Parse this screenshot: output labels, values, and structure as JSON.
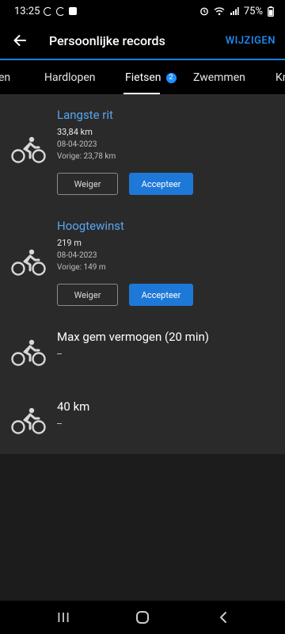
{
  "status": {
    "time": "13:25",
    "battery": "75%"
  },
  "appbar": {
    "title": "Persoonlijke records",
    "edit_label": "WIJZIGEN"
  },
  "tabs": [
    {
      "label": "en"
    },
    {
      "label": "Hardlopen"
    },
    {
      "label": "Fietsen",
      "badge": "2"
    },
    {
      "label": "Zwemmen"
    },
    {
      "label": "Kr"
    }
  ],
  "records": [
    {
      "title": "Langste rit",
      "value": "33,84 km",
      "date": "08-04-2023",
      "previous": "Vorige: 23,78 km",
      "reject_label": "Weiger",
      "accept_label": "Accepteer"
    },
    {
      "title": "Hoogtewinst",
      "value": "219 m",
      "date": "08-04-2023",
      "previous": "Vorige: 149 m",
      "reject_label": "Weiger",
      "accept_label": "Accepteer"
    },
    {
      "title": "Max gem vermogen (20 min)",
      "value": "--"
    },
    {
      "title": "40 km",
      "value": "--"
    }
  ],
  "colors": {
    "accent": "#1e90ff",
    "button": "#1e78d8",
    "link": "#58a6ef"
  },
  "icons": [
    "back-arrow-icon",
    "bike-icon",
    "recents-icon",
    "home-icon",
    "back-nav-icon"
  ]
}
